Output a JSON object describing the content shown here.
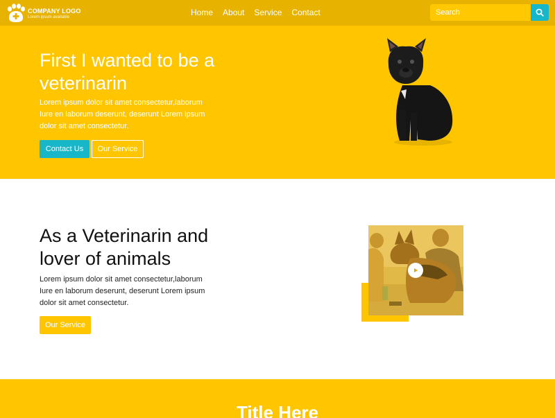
{
  "brand": {
    "title": "COMPANY LOGO",
    "subtitle": "Lorem ipsum available"
  },
  "nav": {
    "links": [
      "Home",
      "About",
      "Service",
      "Contact"
    ]
  },
  "search": {
    "placeholder": "Search"
  },
  "hero": {
    "title": "First I wanted to be a veterinarin",
    "text": "Lorem ipsum dolor sit amet consectetur,laborum Iure en laborum deserunt, deserunt Lorem ipsum dolor sit amet consectetur.",
    "primary_button": "Contact Us",
    "secondary_button": "Our Service"
  },
  "about": {
    "title": "As a Veterinarin and lover of animals",
    "text": "Lorem ipsum dolor sit amet consectetur,laborum Iure en laborum deserunt, deserunt Lorem ipsum dolor sit amet consectetur.",
    "button": "Our Service"
  },
  "section3": {
    "title": "Title Here"
  },
  "colors": {
    "navbar": "#e8b300",
    "primary_yellow": "#ffc600",
    "teal": "#17b7c9",
    "white": "#ffffff"
  },
  "icons": {
    "logo": "paw-plus-icon",
    "search": "search-icon",
    "play": "play-icon"
  }
}
